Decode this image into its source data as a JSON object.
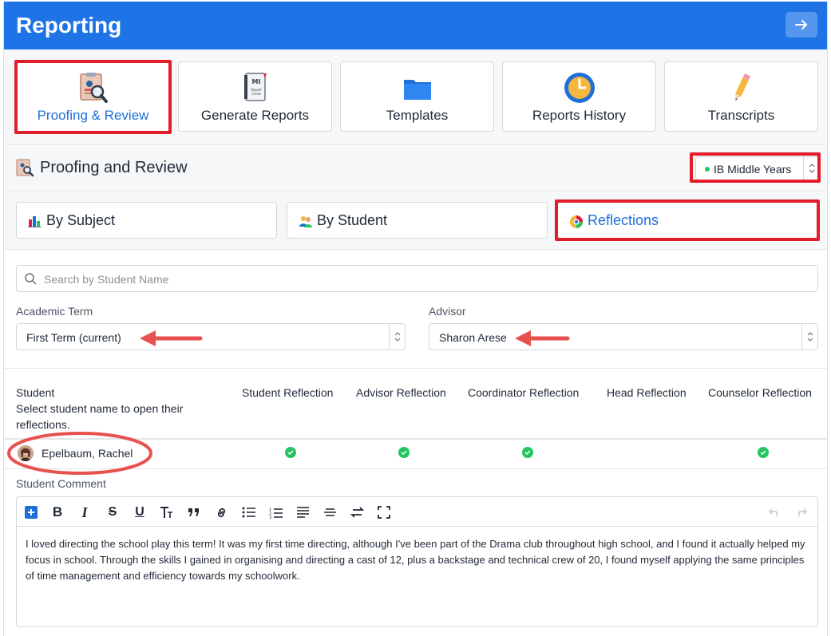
{
  "header": {
    "title": "Reporting"
  },
  "modules": [
    {
      "label": "Proofing & Review",
      "icon": "proofing-icon"
    },
    {
      "label": "Generate Reports",
      "icon": "report-cards-icon"
    },
    {
      "label": "Templates",
      "icon": "folder-icon"
    },
    {
      "label": "Reports History",
      "icon": "clock-icon"
    },
    {
      "label": "Transcripts",
      "icon": "pencil-icon"
    }
  ],
  "section": {
    "title": "Proofing and Review",
    "program": "IB Middle Years"
  },
  "view_tabs": [
    {
      "label": "By Subject",
      "icon": "bar-chart-icon"
    },
    {
      "label": "By Student",
      "icon": "users-icon"
    },
    {
      "label": "Reflections",
      "icon": "reflections-icon"
    }
  ],
  "search": {
    "placeholder": "Search by Student Name"
  },
  "filters": {
    "term_label": "Academic Term",
    "term_value": "First Term (current)",
    "advisor_label": "Advisor",
    "advisor_value": "Sharon Arese"
  },
  "table": {
    "student_header": "Student",
    "student_hint": "Select student name to open their reflections.",
    "columns": [
      "Student Reflection",
      "Advisor Reflection",
      "Coordinator Reflection",
      "Head Reflection",
      "Counselor Reflection"
    ],
    "rows": [
      {
        "name": "Epelbaum, Rachel",
        "status": [
          true,
          true,
          true,
          false,
          true
        ]
      }
    ]
  },
  "comment": {
    "label": "Student Comment",
    "text": "I loved directing the school play this term! It was my first time directing, although I've been part of the Drama club throughout high school, and I found it actually helped my focus in school. Through the skills I gained in organising and directing a cast of 12, plus a backstage and technical crew of 20, I found myself applying the same principles of time management and efficiency towards my schoolwork."
  },
  "colors": {
    "brand": "#1e74e6",
    "active_text": "#1e6fd9",
    "annotation": "#e11d2a",
    "success": "#22c55e"
  }
}
